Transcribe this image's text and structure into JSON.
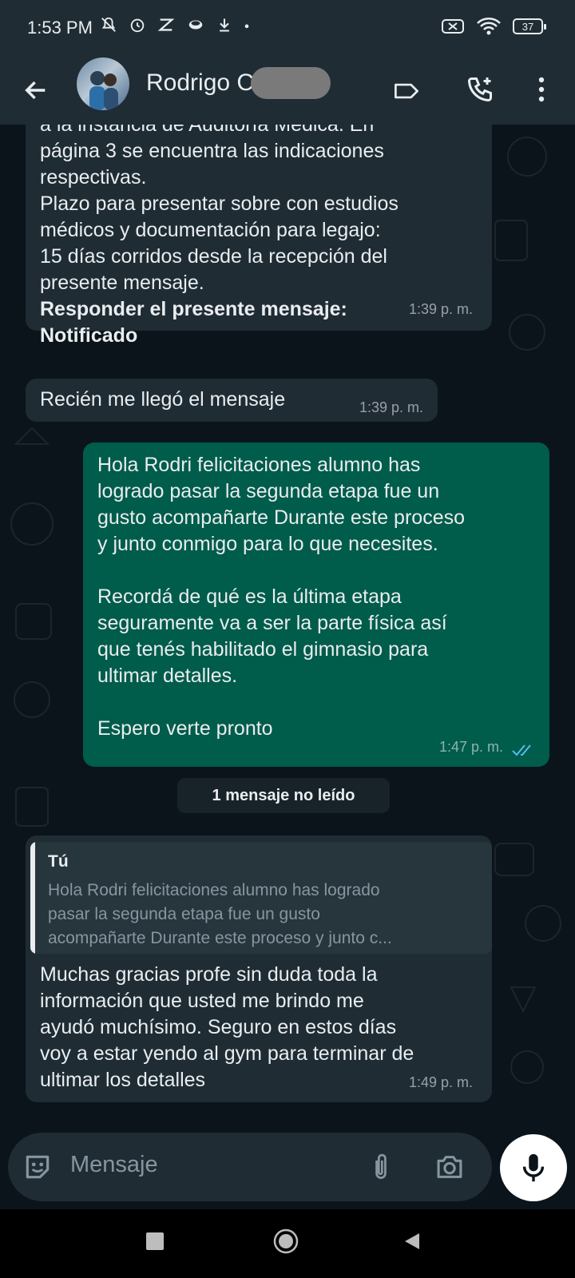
{
  "status_bar": {
    "time": "1:53 PM",
    "battery": "37",
    "icons": [
      "muted-icon",
      "alarm-icon",
      "app-icon",
      "cloud-icon",
      "download-icon",
      "dot-icon",
      "sim-off-icon",
      "wifi-icon"
    ]
  },
  "header": {
    "contact_name": "Rodrigo C",
    "icons": [
      "back-arrow-icon",
      "label-icon",
      "add-call-icon",
      "more-vert-icon"
    ]
  },
  "messages": {
    "m1": {
      "lines": [
        "a la instancia de Auditoría Médica. En",
        "página 3 se encuentra las indicaciones",
        "respectivas.",
        "Plazo para presentar sobre con estudios",
        "médicos y documentación para legajo:",
        "15 días corridos desde la recepción del",
        "presente mensaje."
      ],
      "bold_lines": [
        "Responder el presente mensaje:",
        "Notificado"
      ],
      "time": "1:39 p. m."
    },
    "m2": {
      "text": "Recién me llegó el mensaje",
      "time": "1:39 p. m."
    },
    "m3": {
      "lines": [
        "Hola Rodri felicitaciones alumno has",
        "logrado pasar la segunda etapa fue un",
        "gusto acompañarte Durante este proceso",
        "y junto conmigo para lo que necesites.",
        "",
        "Recordá de qué es la última etapa",
        "seguramente va a ser la parte física así",
        "que tenés habilitado el gimnasio para",
        "ultimar detalles.",
        "",
        "Espero  verte pronto"
      ],
      "time": "1:47 p. m."
    },
    "unread_divider": "1 mensaje no leído",
    "m4": {
      "quote_author": "Tú",
      "quote_lines": [
        "Hola Rodri felicitaciones alumno has logrado",
        "pasar la segunda etapa fue un gusto",
        "acompañarte Durante este proceso y junto c..."
      ],
      "lines": [
        "Muchas gracias profe sin duda toda la",
        "información que usted me brindo me",
        "ayudó muchísimo. Seguro en estos días",
        "voy a estar yendo al gym para terminar de",
        "ultimar los detalles"
      ],
      "time": "1:49 p. m."
    }
  },
  "composer": {
    "placeholder": "Mensaje",
    "icons": [
      "emoji-icon",
      "attach-icon",
      "camera-icon",
      "mic-icon"
    ]
  },
  "nav_bar": {
    "icons": [
      "recents-icon",
      "home-icon",
      "back-icon"
    ]
  },
  "colors": {
    "background": "#0b141a",
    "header": "#1f2c34",
    "incoming_bubble": "#1f2c34",
    "outgoing_bubble": "#005c4b",
    "read_ticks": "#53bdeb"
  }
}
